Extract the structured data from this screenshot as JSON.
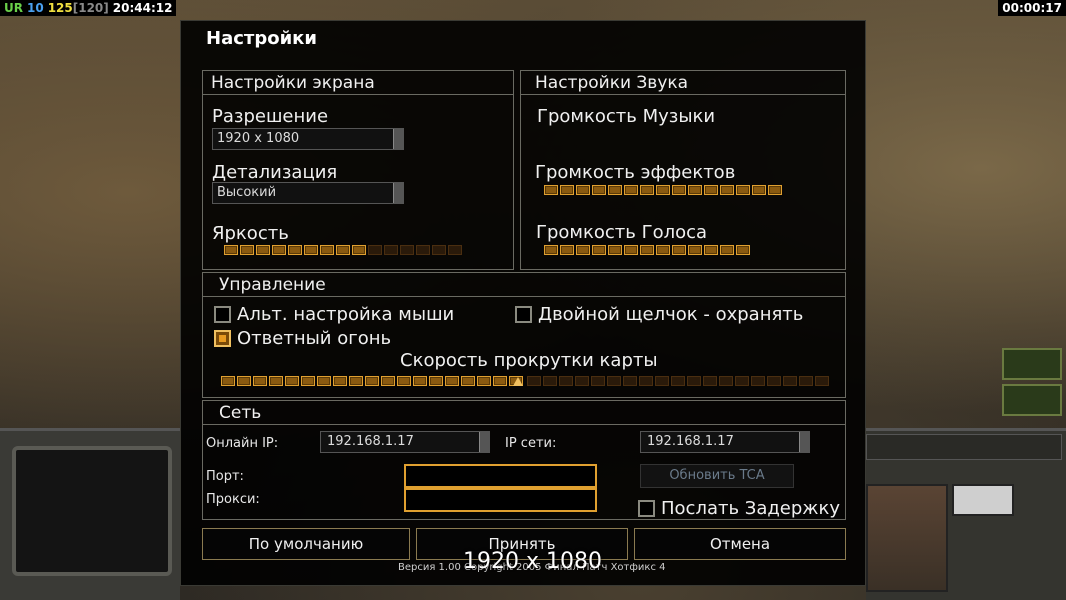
{
  "hud": {
    "ur": "UR",
    "n1": "10",
    "n2": "125",
    "n3": "[120]",
    "clock": "20:44:12",
    "timer": "00:00:17"
  },
  "dialog": {
    "title": "Настройки",
    "screen": {
      "header": "Настройки экрана",
      "resolution_label": "Разрешение",
      "resolution_value": "1920 x 1080",
      "detail_label": "Детализация",
      "detail_value": "Высокий",
      "brightness_label": "Яркость",
      "brightness_level": 0.6
    },
    "sound": {
      "header": "Настройки Звука",
      "music_label": "Громкость Музыки",
      "effects_label": "Громкость эффектов",
      "effects_level": 1.0,
      "voice_label": "Громкость Голоса",
      "voice_level": 1.0
    },
    "controls": {
      "header": "Управление",
      "alt_mouse_label": "Альт. настройка мыши",
      "alt_mouse_checked": false,
      "double_click_label": "Двойной щелчок - охранять",
      "double_click_checked": false,
      "return_fire_label": "Ответный огонь",
      "return_fire_checked": true,
      "scroll_label": "Скорость прокрутки карты",
      "scroll_level": 0.5
    },
    "network": {
      "header": "Сеть",
      "online_ip_label": "Онлайн IP:",
      "online_ip_value": "192.168.1.17",
      "lan_ip_label": "IP сети:",
      "lan_ip_value": "192.168.1.17",
      "port_label": "Порт:",
      "proxy_label": "Прокси:",
      "update_tca_label": "Обновить TCA",
      "send_delay_label": "Послать Задержку",
      "send_delay_checked": false
    },
    "buttons": {
      "default": "По умолчанию",
      "accept": "Принять",
      "cancel": "Отмена"
    },
    "version": "Версия 1.00 Copyright 2005 Финал Патч Хотфикс 4",
    "overlay_resolution": "1920 x 1080"
  },
  "colors": {
    "accent": "#e0a030",
    "ur": "#6ad04a",
    "n1": "#4aa0f0",
    "n2": "#f0e040",
    "n3": "#8a8a8a"
  }
}
